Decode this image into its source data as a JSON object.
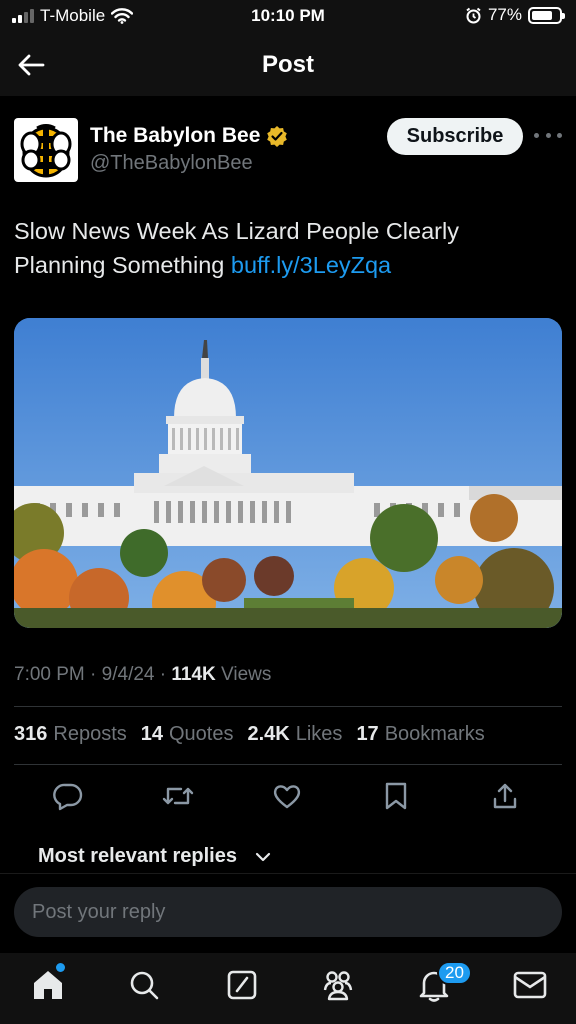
{
  "status_bar": {
    "carrier": "T-Mobile",
    "time": "10:10 PM",
    "battery": "77%",
    "battery_level": 0.77,
    "icons": [
      "signal-icon",
      "wifi-icon",
      "alarm-icon",
      "battery-icon"
    ]
  },
  "nav": {
    "title": "Post",
    "back_icon": "arrow-left-icon"
  },
  "author": {
    "name": "The Babylon Bee",
    "handle": "@TheBabylonBee",
    "verified_icon": "gold-verified-badge-icon",
    "subscribe_label": "Subscribe",
    "more_icon": "more-horizontal-icon"
  },
  "post": {
    "text": "Slow News Week As Lizard People Clearly Planning Something ",
    "link": "buff.ly/3LeyZqa",
    "image_alt": "capitol-building-photo"
  },
  "meta": {
    "time": "7:00 PM",
    "sep1": " · ",
    "date": "9/4/24",
    "sep2": " · ",
    "views_count": "114K",
    "views_label": " Views"
  },
  "stats": [
    {
      "count": "316",
      "label": "Reposts"
    },
    {
      "count": "14",
      "label": "Quotes"
    },
    {
      "count": "2.4K",
      "label": "Likes"
    },
    {
      "count": "17",
      "label": "Bookmarks"
    }
  ],
  "actions": [
    "reply-icon",
    "repost-icon",
    "like-icon",
    "bookmark-icon",
    "share-icon"
  ],
  "replies": {
    "sort_label": "Most relevant replies",
    "chevron_icon": "chevron-down-icon"
  },
  "reply_input": {
    "placeholder": "Post your reply"
  },
  "tab_bar": {
    "tabs": [
      "home-icon",
      "search-icon",
      "compose-icon",
      "communities-icon",
      "notifications-icon",
      "messages-icon"
    ],
    "notification_count": "20"
  },
  "colors": {
    "accent": "#1d9bf0",
    "background": "#000000",
    "secondary_text": "#71767b",
    "verified_gold": "#e8b829"
  }
}
